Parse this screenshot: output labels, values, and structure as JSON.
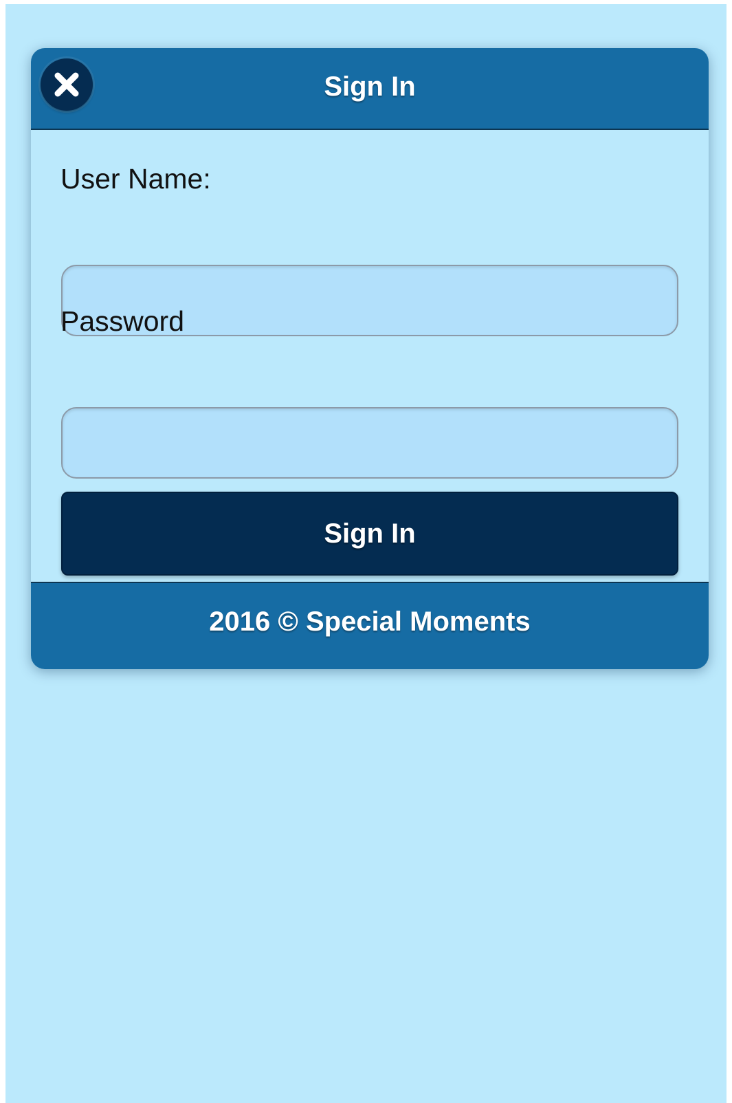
{
  "dialog": {
    "title": "Sign In",
    "close_icon": "close-icon"
  },
  "form": {
    "username_label": "User Name:",
    "username_value": "",
    "password_label": "Password",
    "password_value": "",
    "submit_label": "Sign In"
  },
  "footer": {
    "text": "2016 © Special Moments"
  },
  "colors": {
    "background": "#bbe9fc",
    "header": "#166ca4",
    "button": "#042c51",
    "input": "#b2e0fb"
  }
}
